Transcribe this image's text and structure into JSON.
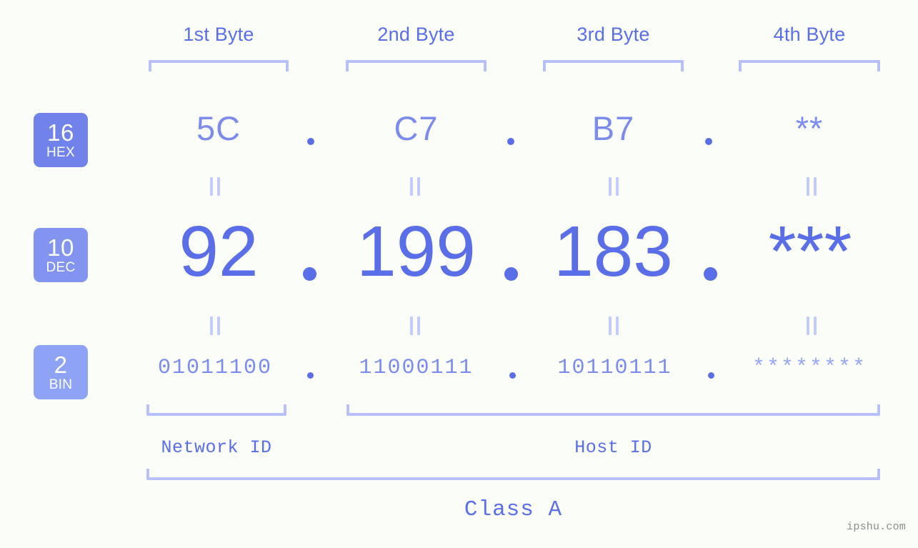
{
  "meta": {
    "background_color": "#fbfdf9",
    "accent_primary": "#5a6ee8",
    "accent_secondary": "#7b8cec",
    "accent_light": "#b7c0f8",
    "watermark": "ipshu.com"
  },
  "byte_headers": [
    {
      "label": "1st Byte"
    },
    {
      "label": "2nd Byte"
    },
    {
      "label": "3rd Byte"
    },
    {
      "label": "4th Byte"
    }
  ],
  "bases": [
    {
      "number": "16",
      "name": "HEX",
      "color": "#7183ea"
    },
    {
      "number": "10",
      "name": "DEC",
      "color": "#8294ef"
    },
    {
      "number": "2",
      "name": "BIN",
      "color": "#8fa3f6"
    }
  ],
  "rows": {
    "hex": {
      "values": [
        "5C",
        "C7",
        "B7",
        "**"
      ],
      "separators": [
        ".",
        ".",
        "."
      ]
    },
    "dec": {
      "values": [
        "92",
        "199",
        "183",
        "***"
      ],
      "separators": [
        ".",
        ".",
        "."
      ]
    },
    "bin": {
      "values": [
        "01011100",
        "11000111",
        "10110111",
        "********"
      ],
      "separators": [
        ".",
        ".",
        "."
      ]
    }
  },
  "connectors": {
    "symbol": "="
  },
  "id_sections": [
    {
      "label": "Network ID"
    },
    {
      "label": "Host ID"
    }
  ],
  "class": {
    "label": "Class A"
  }
}
